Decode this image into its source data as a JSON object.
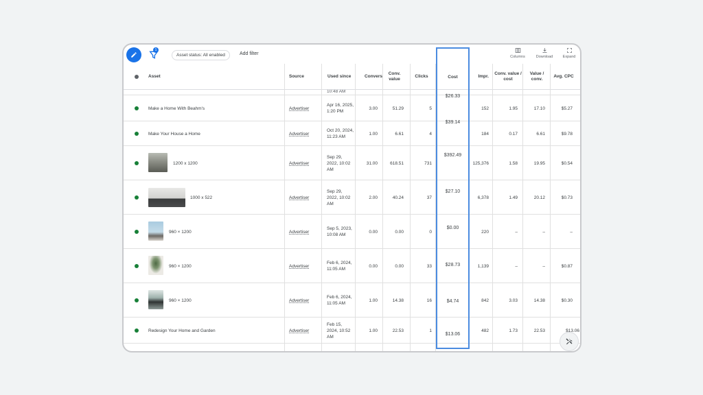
{
  "toolbar": {
    "status_chip": "Asset status: All enabled",
    "add_filter": "Add filter",
    "filter_badge": "1",
    "columns": "Columns",
    "download": "Download",
    "expand": "Expand"
  },
  "columns": {
    "asset": "Asset",
    "source": "Source",
    "used_since": "Used since",
    "conversions": "Convers",
    "conv_value": "Conv. value",
    "clicks": "Clicks",
    "cost": "Cost",
    "impr": "Impr.",
    "conv_value_cost": "Conv. value / cost",
    "value_conv": "Value / conv.",
    "avg_cpc": "Avg. CPC"
  },
  "partial_top": {
    "used_since": "10:48 AM"
  },
  "rows": [
    {
      "asset": "Make a Home With Beahm's",
      "source": "Advertiser",
      "used_since": "Apr 16, 2025, 1:20 PM",
      "conversions": "3.00",
      "conv_value": "51.29",
      "clicks": "5",
      "cost": "$26.33",
      "impr": "152",
      "conv_value_cost": "1.95",
      "value_conv": "17.10",
      "avg_cpc": "$5.27"
    },
    {
      "asset": "Make Your House a Home",
      "source": "Advertiser",
      "used_since": "Oct 20, 2024, 11:23 AM",
      "conversions": "1.00",
      "conv_value": "6.61",
      "clicks": "4",
      "cost": "$39.14",
      "impr": "184",
      "conv_value_cost": "0.17",
      "value_conv": "6.61",
      "avg_cpc": "$9.78"
    },
    {
      "asset": "1200 x 1200",
      "source": "Advertiser",
      "used_since": "Sep 29, 2022, 10:02 AM",
      "conversions": "31.00",
      "conv_value": "618.51",
      "clicks": "731",
      "cost": "$392.49",
      "impr": "125,376",
      "conv_value_cost": "1.58",
      "value_conv": "19.95",
      "avg_cpc": "$0.54"
    },
    {
      "asset": "1000 x 522",
      "source": "Advertiser",
      "used_since": "Sep 29, 2022, 10:02 AM",
      "conversions": "2.00",
      "conv_value": "40.24",
      "clicks": "37",
      "cost": "$27.10",
      "impr": "6,378",
      "conv_value_cost": "1.49",
      "value_conv": "20.12",
      "avg_cpc": "$0.73"
    },
    {
      "asset": "960 × 1200",
      "source": "Advertiser",
      "used_since": "Sep 5, 2023, 10:08 AM",
      "conversions": "0.00",
      "conv_value": "0.00",
      "clicks": "0",
      "cost": "$0.00",
      "impr": "220",
      "conv_value_cost": "–",
      "value_conv": "–",
      "avg_cpc": "–"
    },
    {
      "asset": "960 × 1200",
      "source": "Advertiser",
      "used_since": "Feb 6, 2024, 11:05 AM",
      "conversions": "0.00",
      "conv_value": "0.00",
      "clicks": "33",
      "cost": "$28.73",
      "impr": "1,139",
      "conv_value_cost": "–",
      "value_conv": "–",
      "avg_cpc": "$0.87"
    },
    {
      "asset": "960 × 1200",
      "source": "Advertiser",
      "used_since": "Feb 6, 2024, 11:05 AM",
      "conversions": "1.00",
      "conv_value": "14.38",
      "clicks": "16",
      "cost": "$4.74",
      "impr": "842",
      "conv_value_cost": "3.03",
      "value_conv": "14.38",
      "avg_cpc": "$0.30"
    },
    {
      "asset": "Redesign Your Home and Garden",
      "source": "Advertiser",
      "used_since": "Feb 15, 2024, 10:52 AM",
      "conversions": "1.00",
      "conv_value": "22.53",
      "clicks": "1",
      "cost": "$13.06",
      "impr": "482",
      "conv_value_cost": "1.73",
      "value_conv": "22.53",
      "avg_cpc": "$13.06"
    }
  ],
  "colors": {
    "accent": "#1a73e8",
    "highlight": "#4a8be0",
    "enabled": "#188038"
  }
}
